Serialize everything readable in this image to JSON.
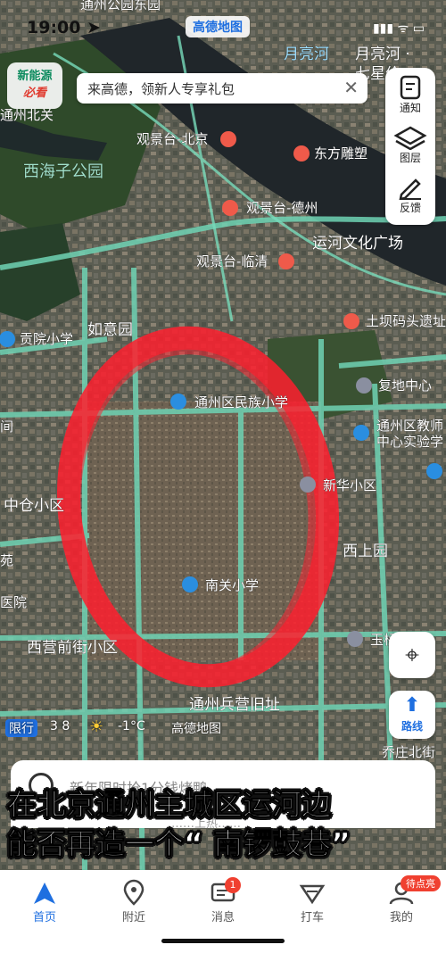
{
  "status": {
    "time": "19:00 ➤",
    "app_name": "高德地图",
    "signal": "▮▮▮ ᯤ ▭"
  },
  "nev_badge": {
    "line1": "新能源",
    "line2": "必看"
  },
  "promo": {
    "text": "来高德，领新人专享礼包",
    "close": "✕"
  },
  "tools": [
    {
      "label": "通知",
      "icon": "notice-icon"
    },
    {
      "label": "图层",
      "icon": "layers-icon"
    },
    {
      "label": "反馈",
      "icon": "feedback-icon"
    }
  ],
  "map": {
    "labels": [
      "通州公园东园",
      "月亮河",
      "月亮河 ·",
      "七星价",
      "通州北关",
      "观景台-北京",
      "东方雕塑",
      "西海子公园",
      "观景台-德州",
      "运河文化广场",
      "观景台-临清",
      "土坝码头遗址",
      "如意园",
      "贡院小学",
      "复地中心",
      "通州区民族小学",
      "通州区教师",
      "中心实验学",
      "中仓小区",
      "新华小区",
      "西上园",
      "南关小学",
      "西营前街小区",
      "通州兵营旧址",
      "医院",
      "间",
      "苑",
      "玉桥",
      "乔庄北街"
    ]
  },
  "buttons": {
    "locate": "⌖",
    "route_arrow": "⬆",
    "route_label": "路线"
  },
  "infobar": {
    "restrict": "限行",
    "restrict_nums": "3 8",
    "weather": "-1°C",
    "brand": "高德地图"
  },
  "search": {
    "placeholder": "新年限时抢1分钱烤鸭",
    "sub": "……上热……"
  },
  "overlay": {
    "line1": "在北京通州主城区运河边",
    "line2": "能否再造一个“ 南锣鼓巷”"
  },
  "tabs": [
    {
      "label": "首页",
      "icon": "home-icon"
    },
    {
      "label": "附近",
      "icon": "nearby-icon"
    },
    {
      "label": "消息",
      "icon": "message-icon",
      "badge": "1"
    },
    {
      "label": "打车",
      "icon": "taxi-icon"
    },
    {
      "label": "我的",
      "icon": "profile-icon",
      "badge": "待点亮"
    }
  ]
}
